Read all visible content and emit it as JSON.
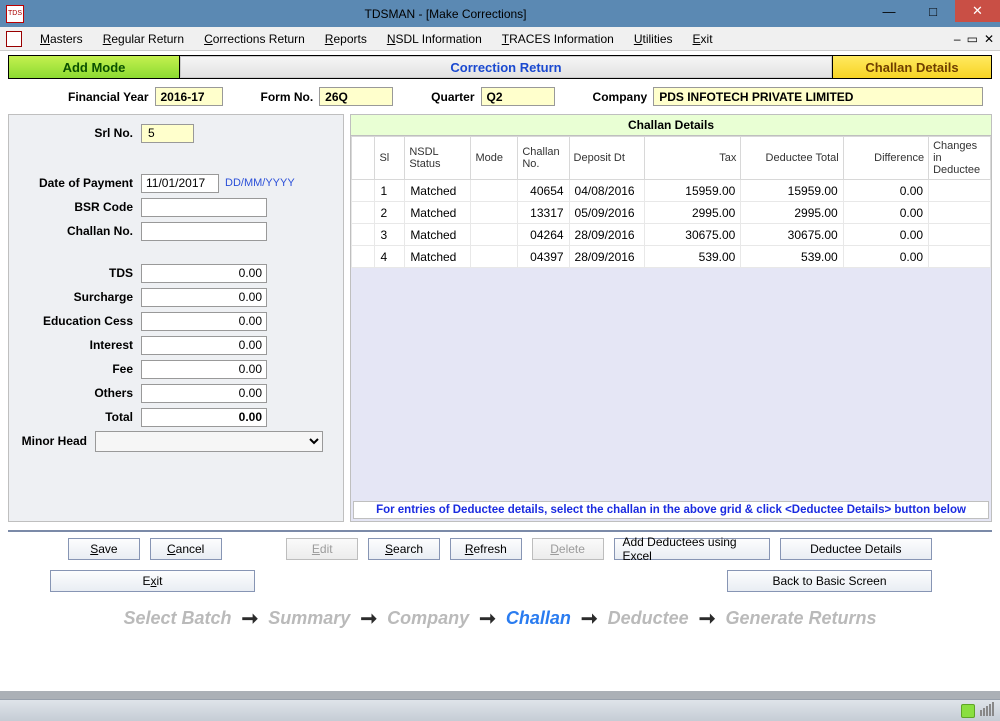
{
  "window": {
    "title": "TDSMAN - [Make Corrections]"
  },
  "menu": {
    "masters": "Masters",
    "regular": "Regular Return",
    "corrections": "Corrections Return",
    "reports": "Reports",
    "nsdl": "NSDL Information",
    "traces": "TRACES Information",
    "utilities": "Utilities",
    "exit": "Exit"
  },
  "topbar": {
    "add": "Add Mode",
    "mid": "Correction Return",
    "det": "Challan Details"
  },
  "filters": {
    "fy_label": "Financial Year",
    "fy": "2016-17",
    "form_label": "Form No.",
    "form": "26Q",
    "qtr_label": "Quarter",
    "qtr": "Q2",
    "company_label": "Company",
    "company": "PDS INFOTECH PRIVATE LIMITED"
  },
  "form": {
    "srl_label": "Srl No.",
    "srl": "5",
    "dop_label": "Date of Payment",
    "dop": "11/01/2017",
    "dop_hint": "DD/MM/YYYY",
    "bsr_label": "BSR Code",
    "bsr": "",
    "challan_label": "Challan No.",
    "challan": "",
    "tds_label": "TDS",
    "tds": "0.00",
    "surcharge_label": "Surcharge",
    "surcharge": "0.00",
    "edu_label": "Education Cess",
    "edu": "0.00",
    "interest_label": "Interest",
    "interest": "0.00",
    "fee_label": "Fee",
    "fee": "0.00",
    "others_label": "Others",
    "others": "0.00",
    "total_label": "Total",
    "total": "0.00",
    "minor_label": "Minor Head",
    "minor": ""
  },
  "grid": {
    "title": "Challan Details",
    "cols": {
      "sl": "Sl",
      "nsdl": "NSDL Status",
      "mode": "Mode",
      "cno": "Challan No.",
      "dep": "Deposit Dt",
      "tax": "Tax",
      "ded": "Deductee Total",
      "diff": "Difference",
      "chg": "Changes in Deductee"
    },
    "rows": [
      {
        "sl": "1",
        "nsdl": "Matched",
        "mode": "",
        "cno": "40654",
        "dep": "04/08/2016",
        "tax": "15959.00",
        "ded": "15959.00",
        "diff": "0.00",
        "chg": ""
      },
      {
        "sl": "2",
        "nsdl": "Matched",
        "mode": "",
        "cno": "13317",
        "dep": "05/09/2016",
        "tax": "2995.00",
        "ded": "2995.00",
        "diff": "0.00",
        "chg": ""
      },
      {
        "sl": "3",
        "nsdl": "Matched",
        "mode": "",
        "cno": "04264",
        "dep": "28/09/2016",
        "tax": "30675.00",
        "ded": "30675.00",
        "diff": "0.00",
        "chg": ""
      },
      {
        "sl": "4",
        "nsdl": "Matched",
        "mode": "",
        "cno": "04397",
        "dep": "28/09/2016",
        "tax": "539.00",
        "ded": "539.00",
        "diff": "0.00",
        "chg": ""
      }
    ],
    "hint": "For entries of Deductee details, select the challan in the above grid & click <Deductee Details> button below"
  },
  "buttons": {
    "save": "Save",
    "cancel": "Cancel",
    "edit": "Edit",
    "search": "Search",
    "refresh": "Refresh",
    "delete": "Delete",
    "add_excel": "Add Deductees using Excel",
    "deductee": "Deductee Details",
    "exit": "Exit",
    "back": "Back to Basic Screen"
  },
  "wizard": {
    "s1": "Select Batch",
    "s2": "Summary",
    "s3": "Company",
    "s4": "Challan",
    "s5": "Deductee",
    "s6": "Generate Returns"
  }
}
